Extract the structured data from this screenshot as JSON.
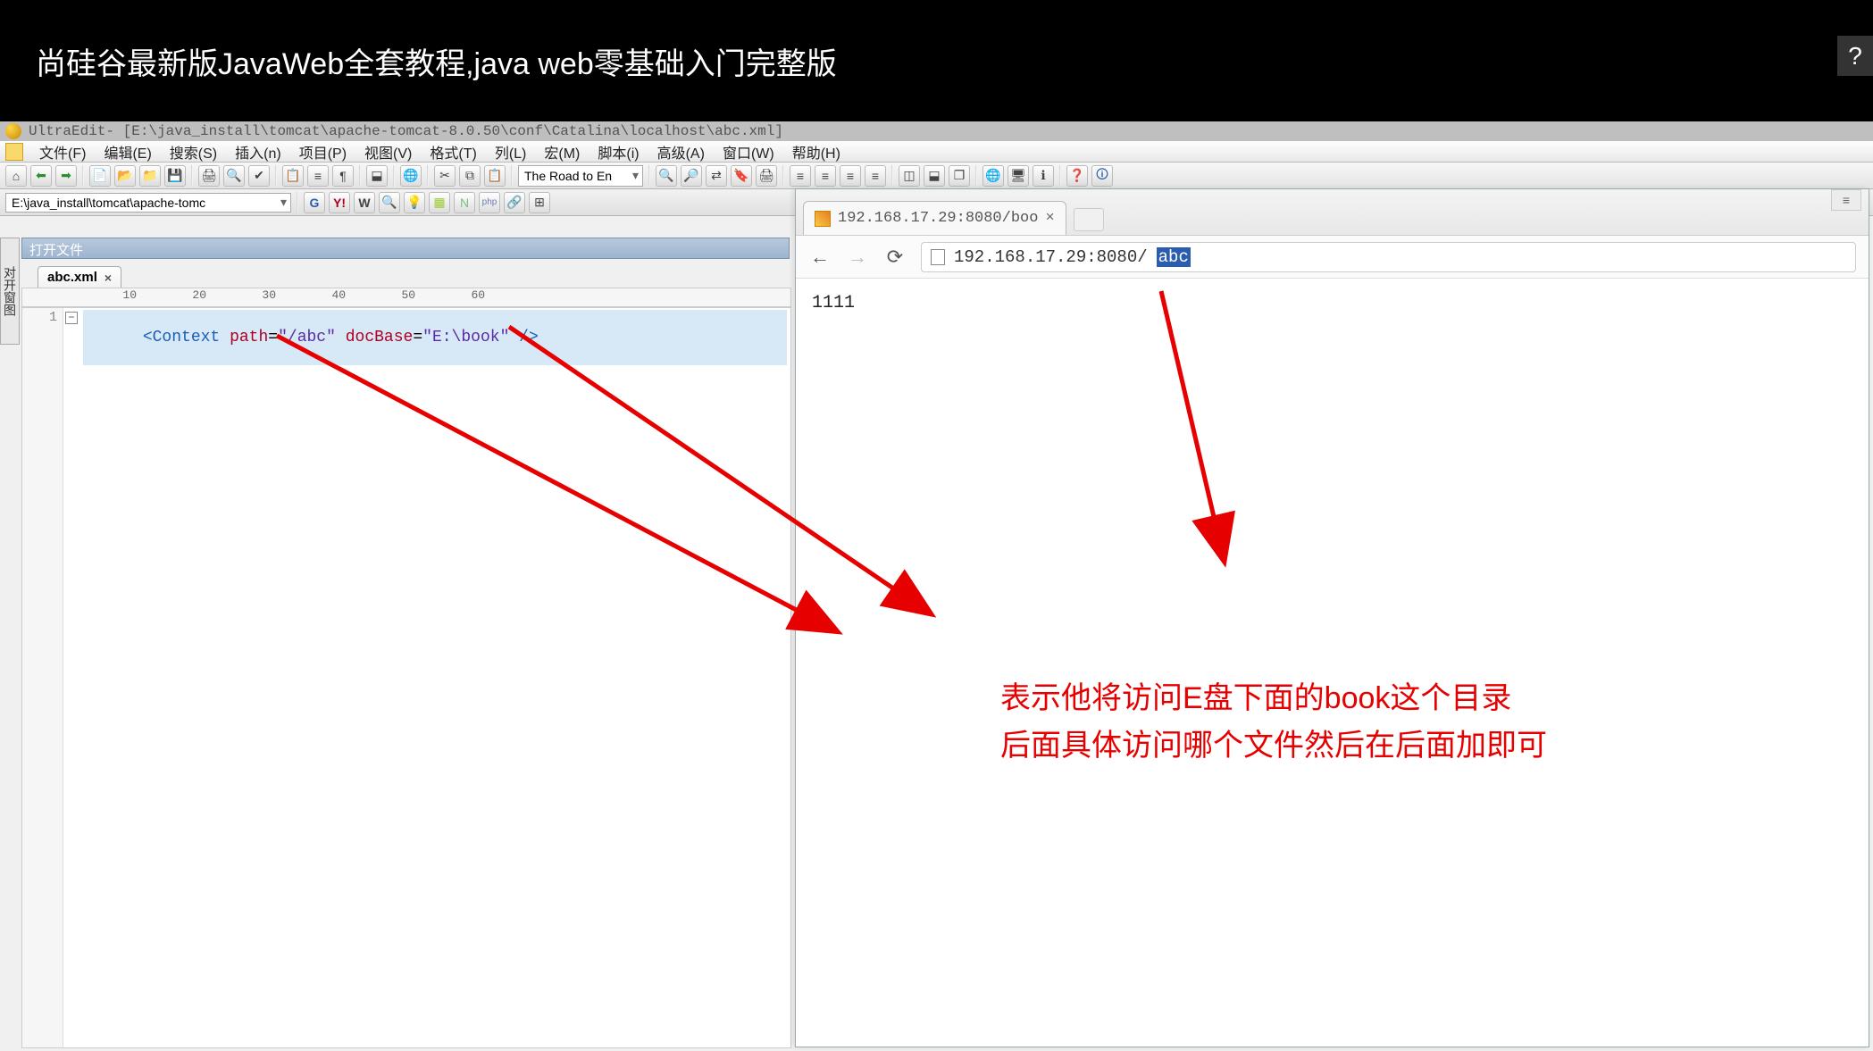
{
  "video": {
    "title": "尚硅谷最新版JavaWeb全套教程,java web零基础入门完整版",
    "help": "?"
  },
  "ultraedit": {
    "title_app": "UltraEdit",
    "title_path": " - [E:\\java_install\\tomcat\\apache-tomcat-8.0.50\\conf\\Catalina\\localhost\\abc.xml]",
    "menus": [
      "文件(F)",
      "编辑(E)",
      "搜索(S)",
      "插入(n)",
      "项目(P)",
      "视图(V)",
      "格式(T)",
      "列(L)",
      "宏(M)",
      "脚本(i)",
      "高级(A)",
      "窗口(W)",
      "帮助(H)"
    ],
    "toolbar_combo": "The Road to En",
    "path_dropdown": "E:\\java_install\\tomcat\\apache-tomc",
    "side_tab": "对开窗图",
    "open_files_label": "打开文件",
    "file_tab": "abc.xml",
    "file_tab_close": "×",
    "ruler": "        10        20        30        40        50        60",
    "line_number": "1",
    "fold_marker": "−",
    "code": {
      "raw": "<Context path=\"/abc\" docBase=\"E:\\book\" />",
      "open": "<",
      "tag": "Context",
      "attr1": "path",
      "val1": "\"/abc\"",
      "attr2": "docBase",
      "val2": "\"E:\\book\"",
      "close": " />"
    }
  },
  "browser": {
    "tab_title": "192.168.17.29:8080/boo",
    "tab_close": "×",
    "url_prefix": "192.168.17.29:8080/",
    "url_selected": "abc",
    "page_content": "1111",
    "menu_corner": "≡"
  },
  "annotation": {
    "line1": "表示他将访问E盘下面的book这个目录",
    "line2": "后面具体访问哪个文件然后在后面加即可"
  }
}
